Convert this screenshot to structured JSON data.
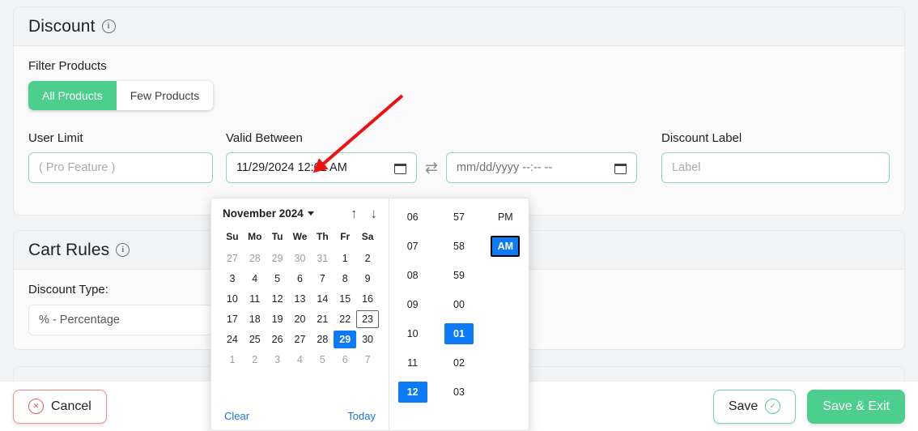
{
  "cards": {
    "discount": {
      "title": "Discount",
      "info_icon": "info-icon",
      "filter_label": "Filter Products",
      "segments": [
        {
          "label": "All Products",
          "active": true
        },
        {
          "label": "Few Products",
          "active": false
        }
      ],
      "fields": {
        "user_limit": {
          "label": "User Limit",
          "value": "",
          "placeholder": "( Pro Feature )"
        },
        "valid_between": {
          "label": "Valid Between",
          "start_value": "11/29/2024 12:01 AM",
          "end_value": "",
          "end_placeholder": "mm/dd/yyyy --:-- --",
          "swap_icon": "swap-arrows-icon",
          "calendar_icon": "calendar-icon"
        },
        "discount_label": {
          "label": "Discount Label",
          "value": "",
          "placeholder": "Label"
        }
      }
    },
    "cart_rules": {
      "title": "Cart Rules",
      "info_icon": "info-icon",
      "discount_type_label": "Discount Type:",
      "discount_type_value": "% - Percentage"
    }
  },
  "datepicker": {
    "month_label": "November 2024",
    "caret_icon": "chevron-down-icon",
    "nav_up_icon": "arrow-up-icon",
    "nav_down_icon": "arrow-down-icon",
    "weekdays": [
      "Su",
      "Mo",
      "Tu",
      "We",
      "Th",
      "Fr",
      "Sa"
    ],
    "weeks": [
      [
        {
          "d": "27",
          "out": true
        },
        {
          "d": "28",
          "out": true
        },
        {
          "d": "29",
          "out": true
        },
        {
          "d": "30",
          "out": true
        },
        {
          "d": "31",
          "out": true
        },
        {
          "d": "1"
        },
        {
          "d": "2"
        }
      ],
      [
        {
          "d": "3"
        },
        {
          "d": "4"
        },
        {
          "d": "5"
        },
        {
          "d": "6"
        },
        {
          "d": "7"
        },
        {
          "d": "8"
        },
        {
          "d": "9"
        }
      ],
      [
        {
          "d": "10"
        },
        {
          "d": "11"
        },
        {
          "d": "12"
        },
        {
          "d": "13"
        },
        {
          "d": "14"
        },
        {
          "d": "15"
        },
        {
          "d": "16"
        }
      ],
      [
        {
          "d": "17"
        },
        {
          "d": "18"
        },
        {
          "d": "19"
        },
        {
          "d": "20"
        },
        {
          "d": "21"
        },
        {
          "d": "22"
        },
        {
          "d": "23",
          "today": true
        }
      ],
      [
        {
          "d": "24"
        },
        {
          "d": "25"
        },
        {
          "d": "26"
        },
        {
          "d": "27"
        },
        {
          "d": "28"
        },
        {
          "d": "29",
          "selected": true
        },
        {
          "d": "30"
        }
      ],
      [
        {
          "d": "1",
          "out": true
        },
        {
          "d": "2",
          "out": true
        },
        {
          "d": "3",
          "out": true
        },
        {
          "d": "4",
          "out": true
        },
        {
          "d": "5",
          "out": true
        },
        {
          "d": "6",
          "out": true
        },
        {
          "d": "7",
          "out": true
        }
      ]
    ],
    "clear_label": "Clear",
    "today_label": "Today",
    "time": {
      "hours": [
        {
          "v": "06"
        },
        {
          "v": "07"
        },
        {
          "v": "08"
        },
        {
          "v": "09"
        },
        {
          "v": "10"
        },
        {
          "v": "11"
        },
        {
          "v": "12",
          "selected": true
        }
      ],
      "minutes": [
        {
          "v": "57"
        },
        {
          "v": "58"
        },
        {
          "v": "59"
        },
        {
          "v": "00"
        },
        {
          "v": "01",
          "selected": true
        },
        {
          "v": "02"
        },
        {
          "v": "03"
        }
      ],
      "meridiem": [
        {
          "v": "PM"
        },
        {
          "v": "AM",
          "selected": true,
          "focused": true
        }
      ]
    }
  },
  "footer": {
    "cancel_label": "Cancel",
    "cancel_icon": "cancel-circle-icon",
    "save_label": "Save",
    "save_icon": "check-circle-icon",
    "save_exit_label": "Save & Exit"
  },
  "annotation": {
    "arrow_color": "#ee1111"
  },
  "colors": {
    "brand_green": "#4cce8d",
    "select_blue": "#0d7bf7",
    "link_blue": "#1a73e8",
    "danger_red": "#e05b5b",
    "page_bg": "#f1f3f5",
    "card_bg": "#fafafa",
    "card_header_bg": "#f1f3f5"
  }
}
